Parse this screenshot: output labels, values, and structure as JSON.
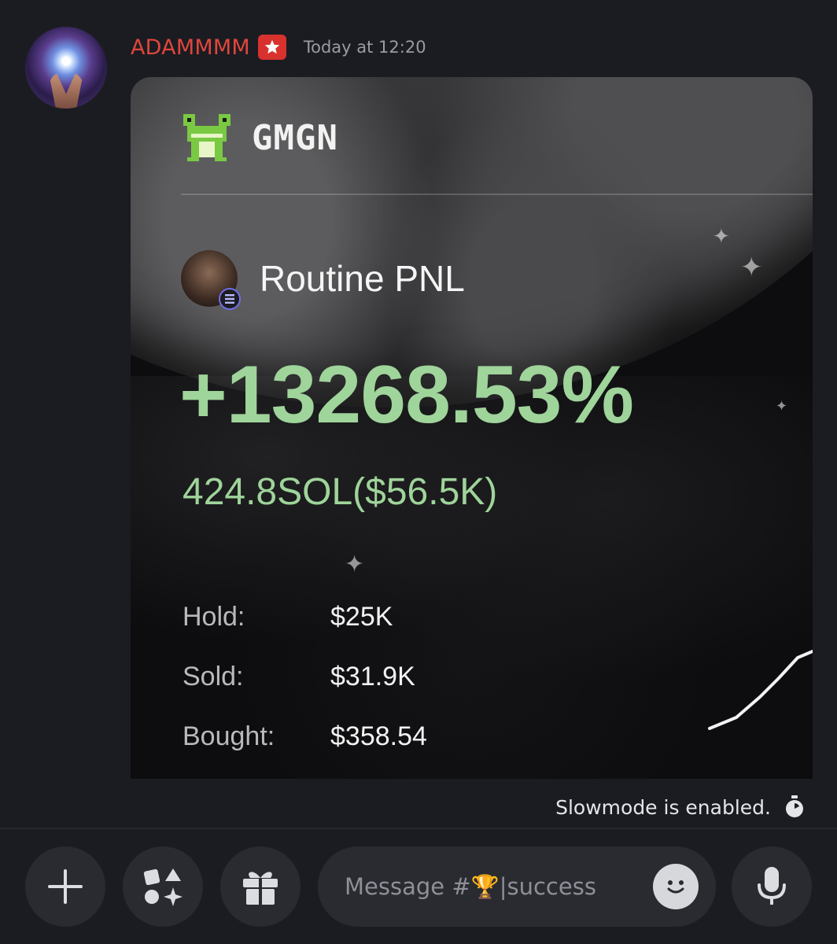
{
  "message": {
    "username": "ADAMMMM",
    "timestamp": "Today at 12:20"
  },
  "card": {
    "brand": "GMGN",
    "token_title": "Routine PNL",
    "pnl_percent": "+13268.53%",
    "pnl_amount": "424.8SOL($56.5K)",
    "stats": [
      {
        "label": "Hold:",
        "value": "$25K"
      },
      {
        "label": "Sold:",
        "value": "$31.9K"
      },
      {
        "label": "Bought:",
        "value": "$358.54"
      }
    ],
    "accent_color": "#9fd49a"
  },
  "slowmode": {
    "text": "Slowmode is enabled."
  },
  "composer": {
    "placeholder": "Message #🏆|success"
  },
  "colors": {
    "username": "#e0463d",
    "background": "#1b1c21",
    "button_bg": "#2a2b31"
  }
}
